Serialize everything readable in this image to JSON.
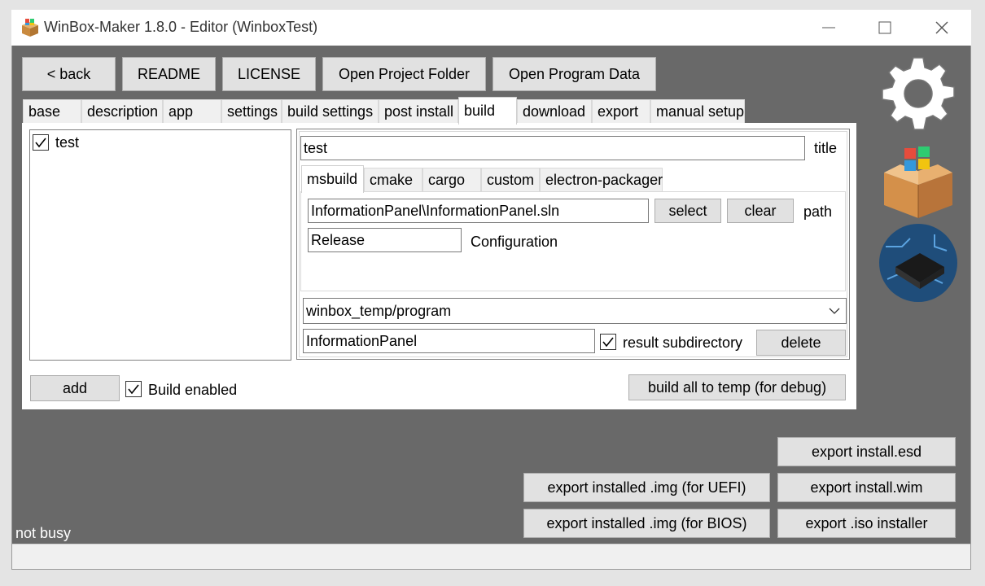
{
  "window": {
    "title": "WinBox-Maker 1.8.0 - Editor (WinboxTest)",
    "minimize_glyph": "—",
    "maximize_glyph": "☐",
    "close_glyph": "✕"
  },
  "toolbar": {
    "back": "< back",
    "readme": "README",
    "license": "LICENSE",
    "open_project_folder": "Open Project Folder",
    "open_program_data": "Open Program Data"
  },
  "tabs": [
    {
      "label": "base"
    },
    {
      "label": "description"
    },
    {
      "label": "app"
    },
    {
      "label": "settings"
    },
    {
      "label": "build settings"
    },
    {
      "label": "post install"
    },
    {
      "label": "build"
    },
    {
      "label": "download"
    },
    {
      "label": "export"
    },
    {
      "label": "manual setup"
    }
  ],
  "active_tab": "build",
  "build_list": {
    "items": [
      {
        "label": "test",
        "checked": true
      }
    ]
  },
  "build_item": {
    "title_value": "test",
    "title_label": "title",
    "subtabs": [
      {
        "label": "msbuild"
      },
      {
        "label": "cmake"
      },
      {
        "label": "cargo"
      },
      {
        "label": "custom"
      },
      {
        "label": "electron-packager"
      }
    ],
    "active_subtab": "msbuild",
    "path_value": "InformationPanel\\InformationPanel.sln",
    "select_label": "select",
    "clear_label": "clear",
    "path_label": "path",
    "configuration_value": "Release",
    "configuration_label": "Configuration",
    "output_dir": "winbox_temp/program",
    "result_name": "InformationPanel",
    "result_subdirectory_label": "result subdirectory",
    "result_subdirectory_checked": true,
    "delete_label": "delete"
  },
  "bottom": {
    "add_label": "add",
    "build_enabled_label": "Build enabled",
    "build_enabled_checked": true,
    "build_all_label": "build all to temp (for debug)"
  },
  "export": {
    "install_esd": "export install.esd",
    "installed_img_uefi": "export installed .img (for UEFI)",
    "install_wim": "export install.wim",
    "installed_img_bios": "export installed .img (for BIOS)",
    "iso_installer": "export .iso installer"
  },
  "status": "not busy",
  "colors": {
    "client_bg": "#696969",
    "button_bg": "#e1e1e1",
    "panel_bg": "#ffffff"
  }
}
